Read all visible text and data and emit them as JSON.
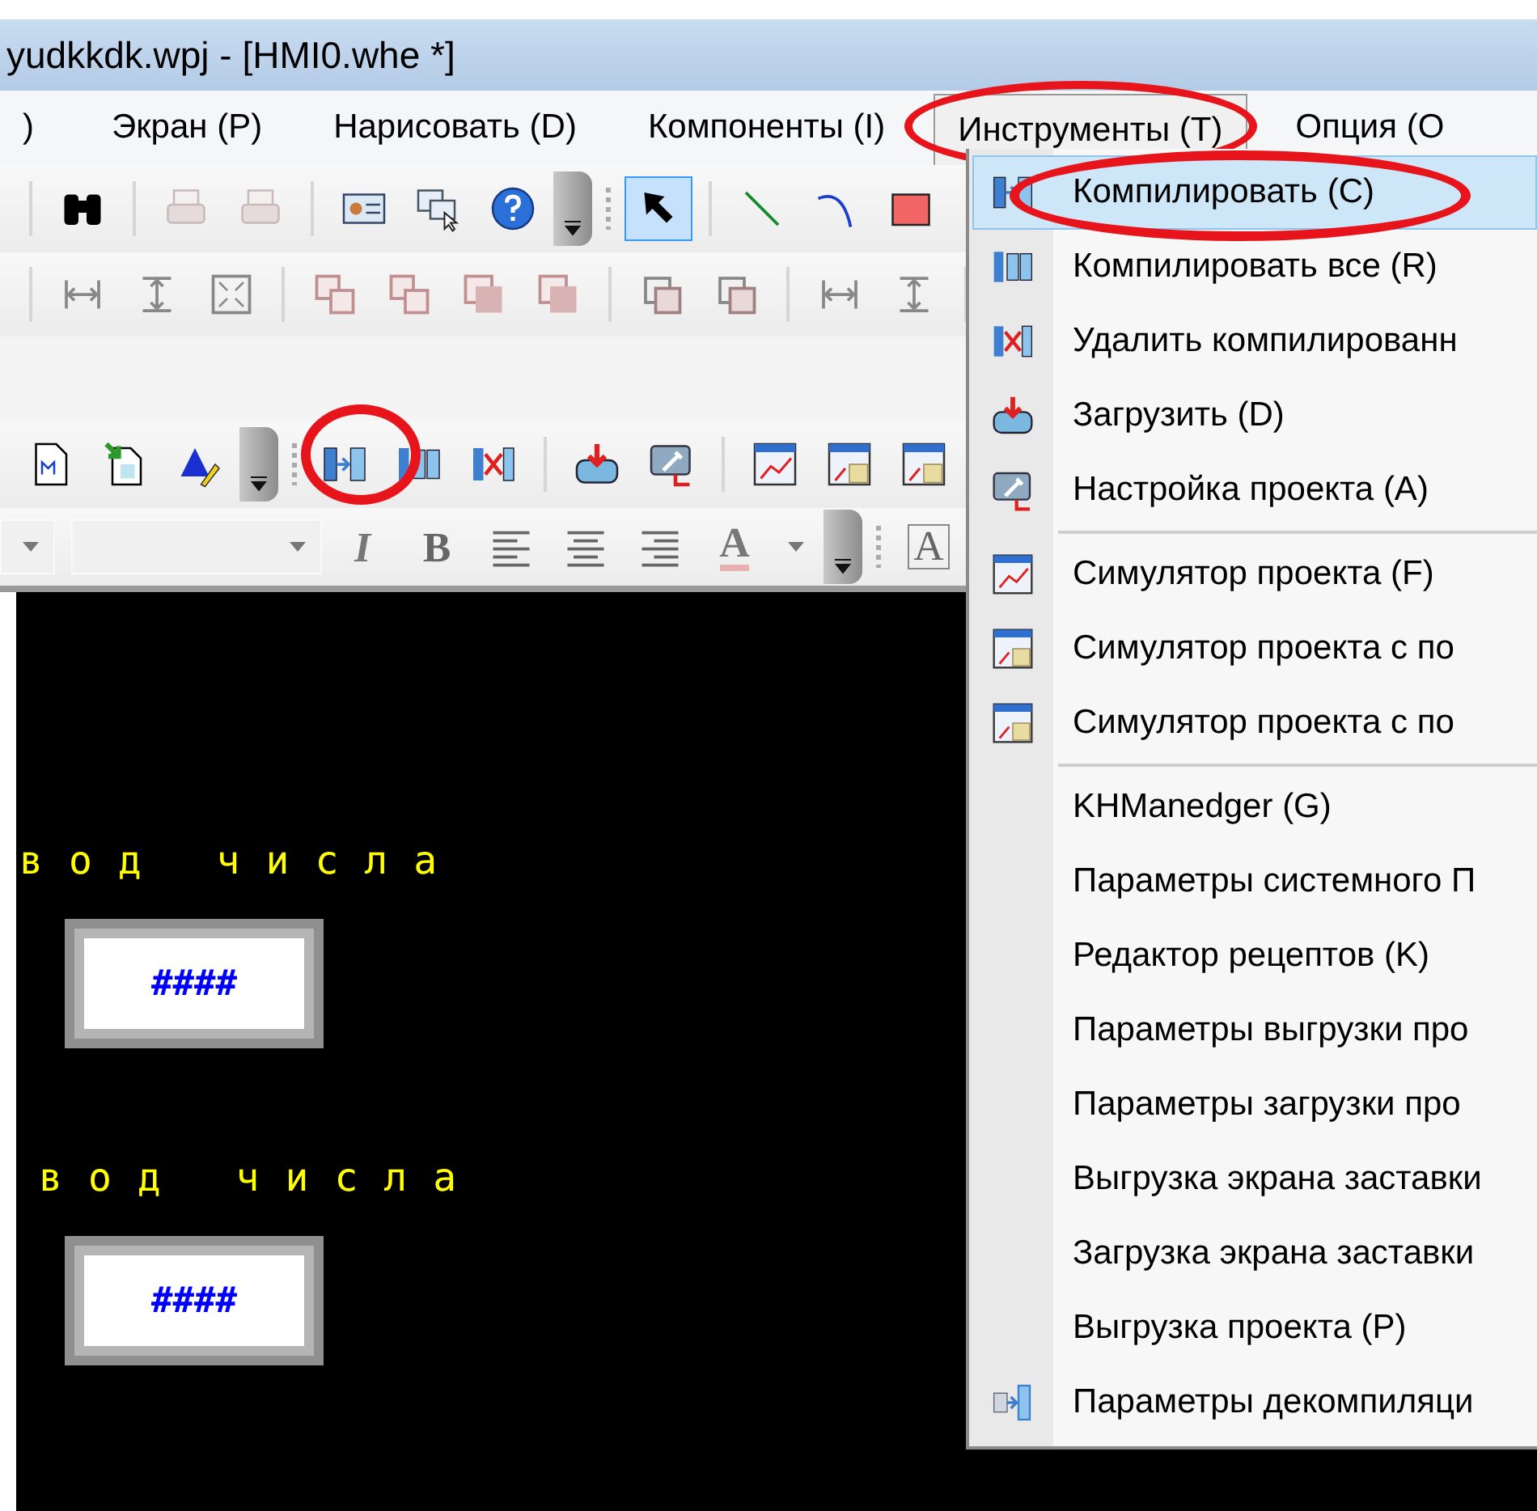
{
  "window": {
    "title": "yudkkdk.wpj - [HMI0.whe *]"
  },
  "menu_bar": [
    {
      "label": ")",
      "selected": false
    },
    {
      "label": "Экран (P)",
      "selected": false
    },
    {
      "label": "Нарисовать (D)",
      "selected": false
    },
    {
      "label": "Компоненты (I)",
      "selected": false
    },
    {
      "label": "Инструменты (T)",
      "selected": true
    },
    {
      "label": "Опция (O",
      "selected": false
    }
  ],
  "toolbars": [
    [
      {
        "kind": "separator"
      },
      {
        "kind": "binoculars",
        "disabled": false,
        "selected": false
      },
      {
        "kind": "separator"
      },
      {
        "kind": "print-preview",
        "disabled": true,
        "selected": false
      },
      {
        "kind": "printer",
        "disabled": true,
        "selected": false
      },
      {
        "kind": "separator"
      },
      {
        "kind": "id-card",
        "disabled": false,
        "selected": false
      },
      {
        "kind": "windows",
        "disabled": false,
        "selected": false
      },
      {
        "kind": "help",
        "disabled": false,
        "selected": false
      },
      {
        "kind": "overflow"
      },
      {
        "kind": "grip"
      },
      {
        "kind": "pointer",
        "disabled": false,
        "selected": true
      },
      {
        "kind": "separator"
      },
      {
        "kind": "line",
        "disabled": false,
        "selected": false
      },
      {
        "kind": "curve",
        "disabled": false,
        "selected": false
      },
      {
        "kind": "rectangle",
        "disabled": false,
        "selected": false
      }
    ],
    [
      {
        "kind": "separator"
      },
      {
        "kind": "h-space"
      },
      {
        "kind": "v-space"
      },
      {
        "kind": "fit"
      },
      {
        "kind": "separator"
      },
      {
        "kind": "layer"
      },
      {
        "kind": "layer"
      },
      {
        "kind": "layer-solid"
      },
      {
        "kind": "layer-solid"
      },
      {
        "kind": "separator"
      },
      {
        "kind": "group"
      },
      {
        "kind": "group"
      },
      {
        "kind": "separator"
      },
      {
        "kind": "h-space"
      },
      {
        "kind": "v-space"
      },
      {
        "kind": "separator"
      }
    ],
    [
      {
        "kind": "doc"
      },
      {
        "kind": "doc-green"
      },
      {
        "kind": "text-style"
      },
      {
        "kind": "overflow"
      },
      {
        "kind": "grip"
      },
      {
        "kind": "compile"
      },
      {
        "kind": "compile-all"
      },
      {
        "kind": "delete-compiled"
      },
      {
        "kind": "separator"
      },
      {
        "kind": "download"
      },
      {
        "kind": "settings"
      },
      {
        "kind": "separator"
      },
      {
        "kind": "sim"
      },
      {
        "kind": "sim-grid"
      },
      {
        "kind": "sim-grid"
      }
    ],
    [
      {
        "kind": "combo-narrow"
      },
      {
        "kind": "combo-wide"
      },
      {
        "kind": "italic",
        "label": "I"
      },
      {
        "kind": "bold",
        "label": "B"
      },
      {
        "kind": "align-left"
      },
      {
        "kind": "align-center"
      },
      {
        "kind": "align-right"
      },
      {
        "kind": "font-color",
        "label": "A"
      },
      {
        "kind": "caret"
      },
      {
        "kind": "overflow"
      },
      {
        "kind": "grip"
      },
      {
        "kind": "text-frame",
        "label": "A"
      }
    ]
  ],
  "canvas": {
    "fields": [
      {
        "label": "вод числа",
        "value": "####"
      },
      {
        "label": "вод числа",
        "value": "####"
      }
    ]
  },
  "dropdown_menu": {
    "groups": [
      [
        {
          "label": "Компилировать (C)",
          "kind": "compile",
          "selected": true
        },
        {
          "label": "Компилировать все (R)",
          "kind": "compile-all",
          "selected": false
        },
        {
          "label": "Удалить компилированн",
          "kind": "delete-compiled",
          "selected": false
        },
        {
          "label": "Загрузить (D)",
          "kind": "download",
          "selected": false
        },
        {
          "label": "Настройка проекта (A)",
          "kind": "settings",
          "selected": false
        }
      ],
      [
        {
          "label": "Симулятор проекта (F)",
          "kind": "sim",
          "selected": false
        },
        {
          "label": "Симулятор проекта с по",
          "kind": "sim-grid",
          "selected": false
        },
        {
          "label": "Симулятор проекта с по",
          "kind": "sim-grid",
          "selected": false
        }
      ],
      [
        {
          "label": "KHManedger (G)",
          "kind": "plain",
          "selected": false
        },
        {
          "label": "Параметры системного П",
          "kind": "plain",
          "selected": false
        },
        {
          "label": "Редактор рецептов (K)",
          "kind": "plain",
          "selected": false
        },
        {
          "label": "Параметры выгрузки про",
          "kind": "plain",
          "selected": false
        },
        {
          "label": "Параметры загрузки про",
          "kind": "plain",
          "selected": false
        },
        {
          "label": "Выгрузка экрана заставки",
          "kind": "plain",
          "selected": false
        },
        {
          "label": "Загрузка экрана заставки",
          "kind": "plain",
          "selected": false
        },
        {
          "label": "Выгрузка проекта (P)",
          "kind": "plain",
          "selected": false
        },
        {
          "label": "Параметры декомпиляци",
          "kind": "decompile",
          "selected": false
        }
      ]
    ]
  }
}
